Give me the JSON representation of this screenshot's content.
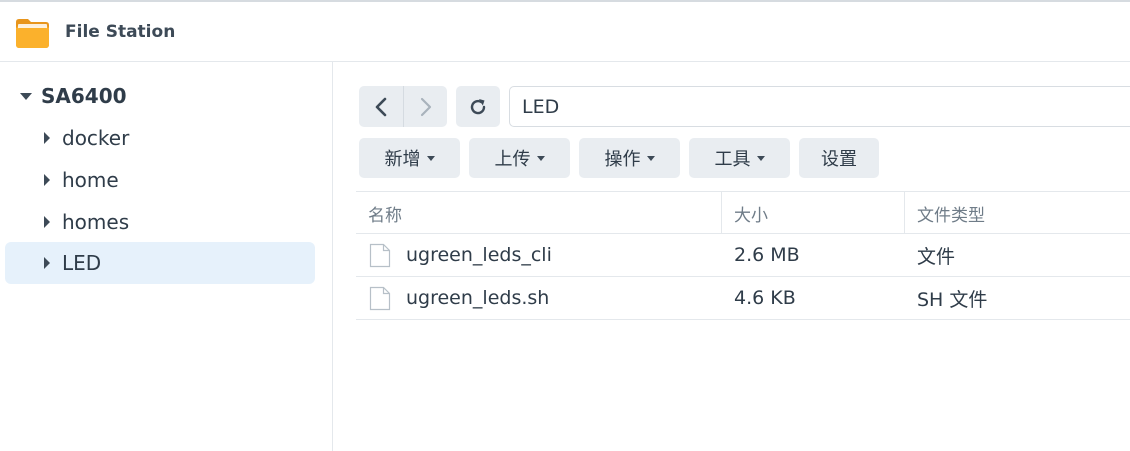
{
  "app": {
    "title": "File Station",
    "icon": "folder-icon",
    "accent": "#f5a623"
  },
  "sidebar": {
    "root_label": "SA6400",
    "items": [
      {
        "label": "docker",
        "selected": false
      },
      {
        "label": "home",
        "selected": false
      },
      {
        "label": "homes",
        "selected": false
      },
      {
        "label": "LED",
        "selected": true
      }
    ],
    "selected_bg": "#e6f1fb"
  },
  "toolbar": {
    "back_icon": "chevron-left-icon",
    "forward_icon": "chevron-right-icon",
    "refresh_icon": "refresh-icon",
    "path": "LED",
    "buttons": [
      {
        "label": "新增",
        "dropdown": true
      },
      {
        "label": "上传",
        "dropdown": true
      },
      {
        "label": "操作",
        "dropdown": true
      },
      {
        "label": "工具",
        "dropdown": true
      },
      {
        "label": "设置",
        "dropdown": false
      }
    ]
  },
  "table": {
    "columns": [
      "名称",
      "大小",
      "文件类型"
    ],
    "rows": [
      {
        "name": "ugreen_leds_cli",
        "size": "2.6 MB",
        "type": "文件",
        "icon": "file-icon"
      },
      {
        "name": "ugreen_leds.sh",
        "size": "4.6 KB",
        "type": "SH 文件",
        "icon": "file-icon"
      }
    ]
  }
}
